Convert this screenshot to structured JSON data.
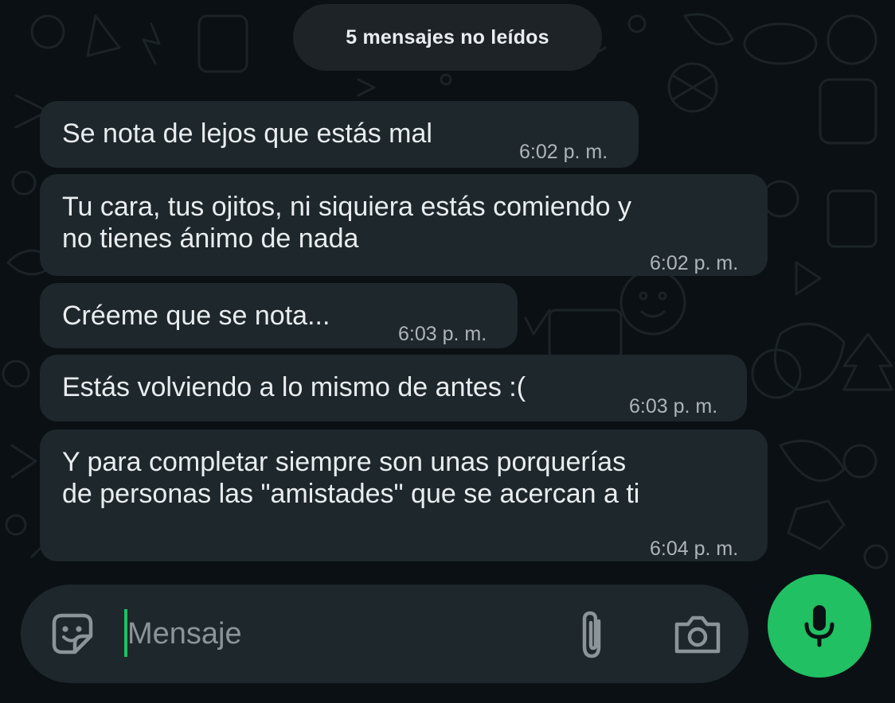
{
  "unread_banner": "5 mensajes no leídos",
  "messages": [
    {
      "text": "Se nota de lejos que estás mal",
      "time": "6:02 p. m."
    },
    {
      "text": "Tu cara, tus ojitos, ni siquiera estás comiendo y\nno tienes ánimo de nada",
      "time": "6:02 p. m."
    },
    {
      "text": "Créeme que se nota...",
      "time": "6:03 p. m."
    },
    {
      "text": "Estás volviendo a lo mismo de antes :(",
      "time": "6:03 p. m."
    },
    {
      "text": "Y para completar siempre son unas porquerías\nde personas las \"amistades\" que se acercan a ti",
      "time": "6:04 p. m."
    }
  ],
  "composer": {
    "placeholder": "Mensaje",
    "value": "",
    "icons": [
      "sticker-icon",
      "paperclip-icon",
      "camera-icon",
      "microphone-icon"
    ]
  },
  "colors": {
    "background": "#0b1014",
    "bubble": "#1e272c",
    "text": "#e9edef",
    "timestamp": "#aeb5b9",
    "accent": "#21c063"
  }
}
